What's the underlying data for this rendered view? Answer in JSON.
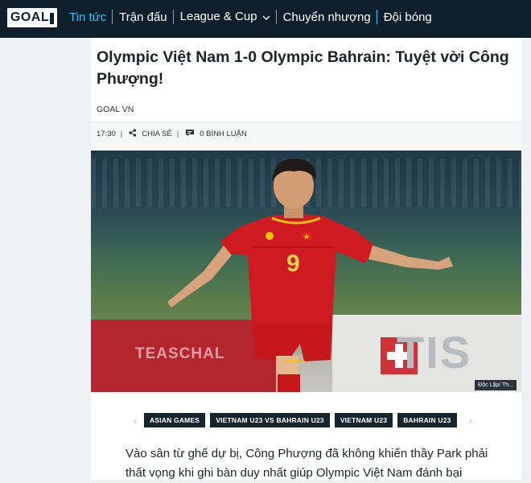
{
  "header": {
    "logo": "GOAL",
    "nav": [
      {
        "label": "Tin tức",
        "active": true
      },
      {
        "label": "Trận đấu",
        "active": false
      },
      {
        "label": "League & Cup",
        "active": false
      },
      {
        "label": "Chuyển nhượng",
        "active": false
      },
      {
        "label": "Đội bóng",
        "active": false
      }
    ],
    "accent_color": "#21c3ff",
    "background_color": "#0e1e2a"
  },
  "article": {
    "title": "Olympic Việt Nam 1-0 Olympic Bahrain: Tuyệt vời Công Phượng!",
    "author": "GOAL VN",
    "time": "17:30",
    "share_label": "CHIA SẺ",
    "comments_label": "0 BÌNH LUẬN",
    "image": {
      "player_number": "9",
      "adboard_left_text": "TEASCHAL",
      "adboard_right_text": "TIS",
      "caption": "Độc Lập/ Th..."
    },
    "tags": [
      "ASIAN GAMES",
      "VIETNAM U23 VS BAHRAIN U23",
      "VIETNAM U23",
      "BAHRAIN U23"
    ],
    "body_first_lines": "Vào sân từ ghế dự bị, Công Phượng đã không khiến thầy Park phải thất vọng khi ghi bàn duy nhất giúp Olympic Việt Nam đánh bại"
  }
}
